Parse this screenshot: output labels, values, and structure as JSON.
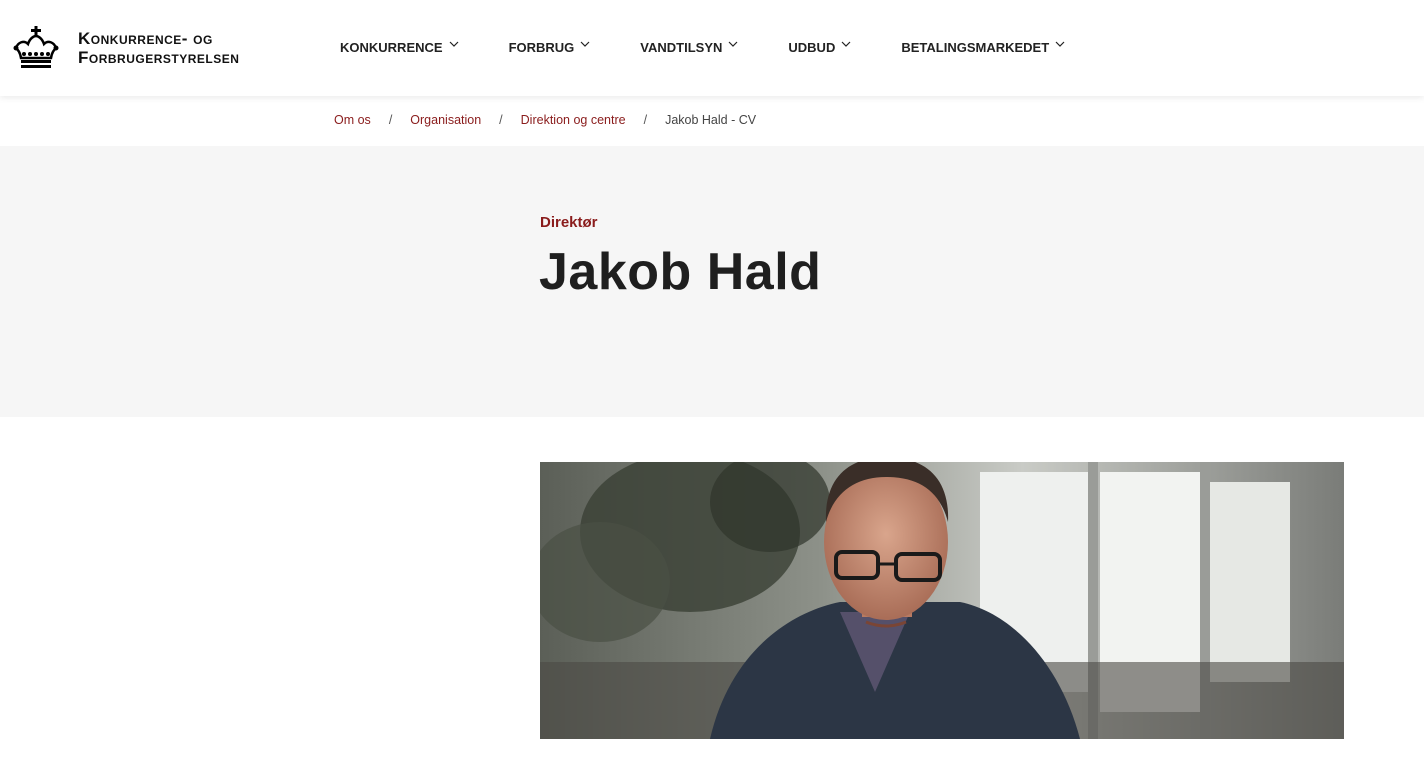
{
  "header": {
    "logo_line1": "Konkurrence- og",
    "logo_line2": "Forbrugerstyrelsen",
    "logo_icon": "crown-icon",
    "nav": [
      {
        "label": "Konkurrence"
      },
      {
        "label": "Forbrug"
      },
      {
        "label": "Vandtilsyn"
      },
      {
        "label": "Udbud"
      },
      {
        "label": "Betalingsmarkedet"
      }
    ]
  },
  "breadcrumb": {
    "items": [
      "Om os",
      "Organisation",
      "Direktion og centre"
    ],
    "current": "Jakob Hald - CV",
    "separator": "/"
  },
  "hero": {
    "role": "Direktør",
    "name": "Jakob Hald"
  },
  "colors": {
    "accent": "#8a1c1c",
    "hero_bg": "#f6f6f6"
  }
}
